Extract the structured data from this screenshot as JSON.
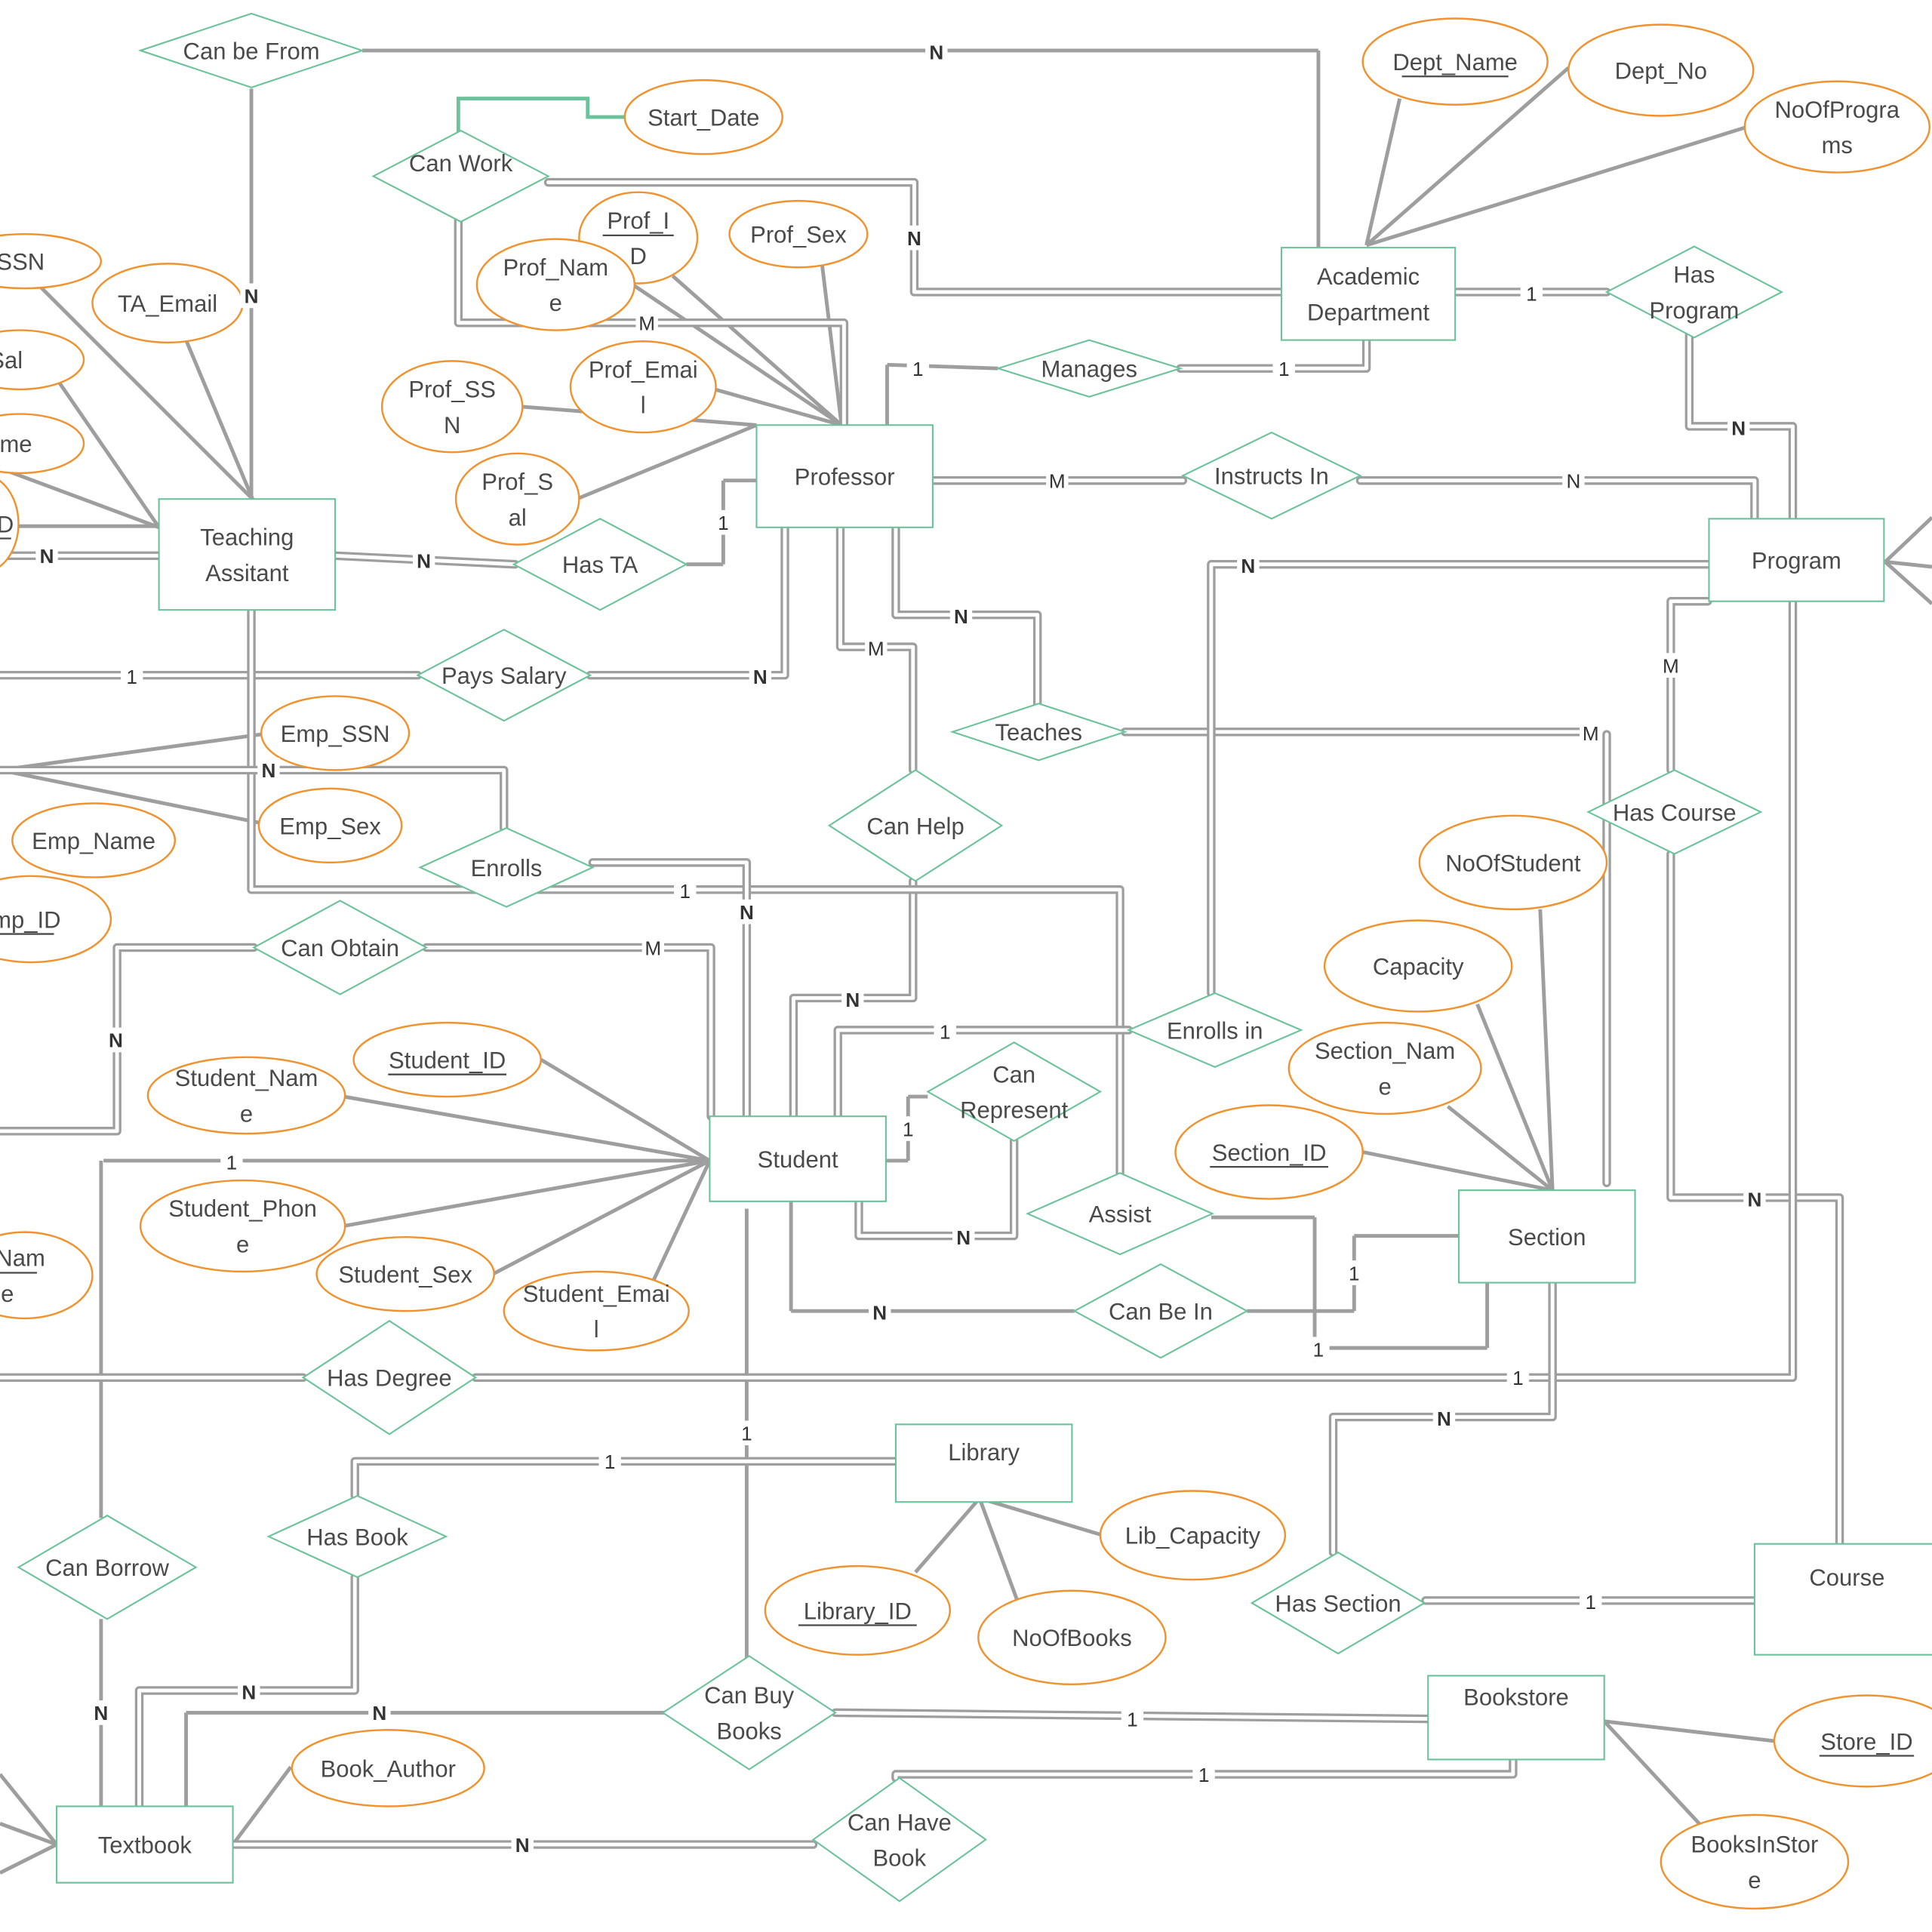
{
  "diagram": {
    "type": "ER diagram",
    "colors": {
      "entity_border": "#6cc39b",
      "relationship_border": "#6cc39b",
      "attribute_border": "#f0922e",
      "connector": "#9e9e9e",
      "text": "#4a4a4a"
    },
    "entities": [
      {
        "id": "academic_department",
        "label": "Academic Department"
      },
      {
        "id": "professor",
        "label": "Professor"
      },
      {
        "id": "teaching_assistant",
        "label": "Teaching Assitant"
      },
      {
        "id": "program",
        "label": "Program"
      },
      {
        "id": "student",
        "label": "Student"
      },
      {
        "id": "section",
        "label": "Section"
      },
      {
        "id": "library",
        "label": "Library"
      },
      {
        "id": "course",
        "label": "Course"
      },
      {
        "id": "bookstore",
        "label": "Bookstore"
      },
      {
        "id": "textbook",
        "label": "Textbook"
      }
    ],
    "relationships": [
      {
        "id": "can_be_from",
        "label": "Can be From"
      },
      {
        "id": "can_work",
        "label": "Can Work"
      },
      {
        "id": "has_program",
        "label": "Has Program"
      },
      {
        "id": "manages",
        "label": "Manages"
      },
      {
        "id": "instructs_in",
        "label": "Instructs In"
      },
      {
        "id": "has_ta",
        "label": "Has TA"
      },
      {
        "id": "pays_salary",
        "label": "Pays Salary"
      },
      {
        "id": "teaches",
        "label": "Teaches"
      },
      {
        "id": "can_help",
        "label": "Can Help"
      },
      {
        "id": "has_course",
        "label": "Has Course"
      },
      {
        "id": "enrolls",
        "label": "Enrolls"
      },
      {
        "id": "can_obtain",
        "label": "Can Obtain"
      },
      {
        "id": "enrolls_in",
        "label": "Enrolls in"
      },
      {
        "id": "can_represent",
        "label": "Can Represent"
      },
      {
        "id": "assist",
        "label": "Assist"
      },
      {
        "id": "can_be_in",
        "label": "Can Be In"
      },
      {
        "id": "has_degree",
        "label": "Has Degree"
      },
      {
        "id": "has_book",
        "label": "Has Book"
      },
      {
        "id": "can_borrow",
        "label": "Can Borrow"
      },
      {
        "id": "can_buy_books",
        "label": "Can Buy Books"
      },
      {
        "id": "has_section",
        "label": "Has Section"
      },
      {
        "id": "can_have_book",
        "label": "Can Have Book"
      }
    ],
    "attributes": [
      {
        "id": "dept_name",
        "label": "Dept_Name",
        "key": true
      },
      {
        "id": "dept_no",
        "label": "Dept_No",
        "key": false
      },
      {
        "id": "noofprograms",
        "label": "NoOfPrograms",
        "key": false
      },
      {
        "id": "start_date",
        "label": "Start_Date",
        "key": false
      },
      {
        "id": "prof_id",
        "label": "Prof_ID",
        "key": true
      },
      {
        "id": "prof_sex",
        "label": "Prof_Sex",
        "key": false
      },
      {
        "id": "prof_name",
        "label": "Prof_Name",
        "key": false
      },
      {
        "id": "prof_email",
        "label": "Prof_Email",
        "key": false
      },
      {
        "id": "prof_ssn",
        "label": "Prof_SSN",
        "key": false
      },
      {
        "id": "prof_sal",
        "label": "Prof_Sal",
        "key": false
      },
      {
        "id": "ta_ssn",
        "label": "TA_SSN",
        "key": false
      },
      {
        "id": "ta_email",
        "label": "TA_Email",
        "key": false
      },
      {
        "id": "ta_sal",
        "label": "TA_Sal",
        "key": false
      },
      {
        "id": "ta_name",
        "label": "TA_Name",
        "key": false
      },
      {
        "id": "ta_id",
        "label": "TA_ID",
        "key": true
      },
      {
        "id": "emp_ssn",
        "label": "Emp_SSN",
        "key": false
      },
      {
        "id": "emp_sex",
        "label": "Emp_Sex",
        "key": false
      },
      {
        "id": "emp_name",
        "label": "Emp_Name",
        "key": false
      },
      {
        "id": "emp_id",
        "label": "Emp_ID",
        "key": true
      },
      {
        "id": "student_id",
        "label": "Student_ID",
        "key": true
      },
      {
        "id": "student_name",
        "label": "Student_Name",
        "key": false
      },
      {
        "id": "student_phone",
        "label": "Student_Phone",
        "key": false
      },
      {
        "id": "student_sex",
        "label": "Student_Sex",
        "key": false
      },
      {
        "id": "student_email",
        "label": "Student_Email",
        "key": false
      },
      {
        "id": "course_name",
        "label": "Course_Name",
        "key": true
      },
      {
        "id": "noofstudent",
        "label": "NoOfStudent",
        "key": false
      },
      {
        "id": "capacity",
        "label": "Capacity",
        "key": false
      },
      {
        "id": "section_name",
        "label": "Section_Name",
        "key": false
      },
      {
        "id": "section_id",
        "label": "Section_ID",
        "key": true
      },
      {
        "id": "lib_capacity",
        "label": "Lib_Capacity",
        "key": false
      },
      {
        "id": "library_id",
        "label": "Library_ID",
        "key": true
      },
      {
        "id": "noofbooks",
        "label": "NoOfBooks",
        "key": false
      },
      {
        "id": "book_author",
        "label": "Book_Author",
        "key": false
      },
      {
        "id": "store_id",
        "label": "Store_ID",
        "key": true
      },
      {
        "id": "booksinstore",
        "label": "BooksInStore",
        "key": false
      }
    ],
    "cardinalities": [
      {
        "id": "c_canbefrom_dept",
        "label": "N"
      },
      {
        "id": "c_canbefrom_ta",
        "label": "N"
      },
      {
        "id": "c_canwork_dept",
        "label": "N"
      },
      {
        "id": "c_canwork_prof",
        "label": "M"
      },
      {
        "id": "c_dept_hasprogram",
        "label": "1"
      },
      {
        "id": "c_hasprogram_program",
        "label": "N"
      },
      {
        "id": "c_manages_prof",
        "label": "1"
      },
      {
        "id": "c_manages_dept",
        "label": "1"
      },
      {
        "id": "c_instructs_prof",
        "label": "M"
      },
      {
        "id": "c_instructs_program",
        "label": "N"
      },
      {
        "id": "c_hasta_prof",
        "label": "1"
      },
      {
        "id": "c_hasta_ta",
        "label": "N"
      },
      {
        "id": "c_ta_left",
        "label": "N"
      },
      {
        "id": "c_pays_left",
        "label": "1"
      },
      {
        "id": "c_pays_prof",
        "label": "N"
      },
      {
        "id": "c_teaches_prof",
        "label": "N"
      },
      {
        "id": "c_teaches_section",
        "label": "M"
      },
      {
        "id": "c_canhelp_prof",
        "label": "M"
      },
      {
        "id": "c_canhelp_student",
        "label": "N"
      },
      {
        "id": "c_enrollsin_program",
        "label": "N"
      },
      {
        "id": "c_enrollsin_student",
        "label": "1"
      },
      {
        "id": "c_hascourse_program",
        "label": "M"
      },
      {
        "id": "c_hascourse_course",
        "label": "N"
      },
      {
        "id": "c_enrolls_ta",
        "label": "N"
      },
      {
        "id": "c_enrolls_student",
        "label": "N"
      },
      {
        "id": "c_assist_ta",
        "label": "1"
      },
      {
        "id": "c_canobtain_left",
        "label": "N"
      },
      {
        "id": "c_canobtain_student",
        "label": "M"
      },
      {
        "id": "c_canrepresent_student1",
        "label": "1"
      },
      {
        "id": "c_canrepresent_student2",
        "label": "N"
      },
      {
        "id": "c_canbein_student",
        "label": "N"
      },
      {
        "id": "c_canbein_section",
        "label": "1"
      },
      {
        "id": "c_assist_section",
        "label": "1"
      },
      {
        "id": "c_canborrow_line",
        "label": "1"
      },
      {
        "id": "c_hasdegree_program",
        "label": "1"
      },
      {
        "id": "c_hassection_section",
        "label": "N"
      },
      {
        "id": "c_hassection_course",
        "label": "1"
      },
      {
        "id": "c_hasbook_library",
        "label": "1"
      },
      {
        "id": "c_student_canbuy",
        "label": "1"
      },
      {
        "id": "c_hasbook_textbook",
        "label": "N"
      },
      {
        "id": "c_canbuy_textbook",
        "label": "N"
      },
      {
        "id": "c_canbuy_bookstore",
        "label": "1"
      },
      {
        "id": "c_canborrow_textbook",
        "label": "N"
      },
      {
        "id": "c_canhave_bookstore",
        "label": "1"
      },
      {
        "id": "c_canhave_textbook",
        "label": "N"
      }
    ]
  }
}
